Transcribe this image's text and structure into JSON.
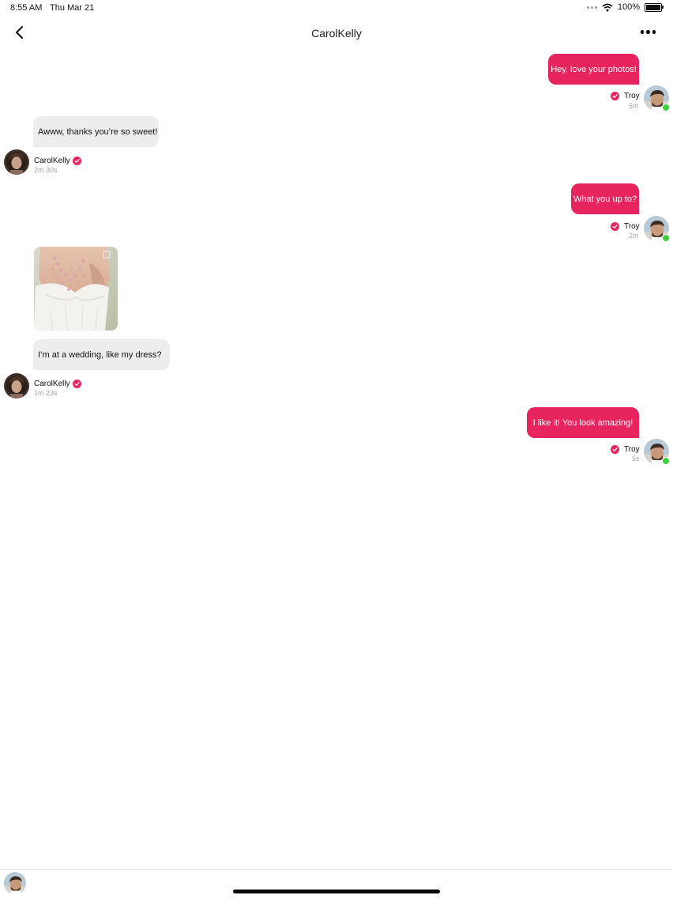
{
  "status_bar": {
    "time": "8:55 AM",
    "date": "Thu Mar 21",
    "battery": "100%",
    "battery_level": 1.0
  },
  "header": {
    "title": "CarolKelly",
    "back_icon": "chevron-left-icon",
    "more_icon": "ellipsis-icon"
  },
  "messages": [
    {
      "side": "out",
      "text": "Hey, love your photos!",
      "sender": "Troy",
      "time": "5m"
    },
    {
      "side": "in",
      "text": "Awww, thanks you’re so sweet!",
      "sender": "CarolKelly",
      "time": "2m 30s"
    },
    {
      "side": "out",
      "text": "What you up to?",
      "sender": "Troy",
      "time": "2m"
    },
    {
      "side": "in",
      "type": "image",
      "image": "wedding-dress-photo"
    },
    {
      "side": "in",
      "text": "I’m at a wedding, like my dress?",
      "sender": "CarolKelly",
      "time": "1m 23s"
    },
    {
      "side": "out",
      "text": "I like it! You look amazing!",
      "sender": "Troy",
      "time": "5s"
    }
  ],
  "colors": {
    "accent": "#e8245e",
    "incoming_bubble": "#ededed",
    "online": "#3ecf3e"
  }
}
